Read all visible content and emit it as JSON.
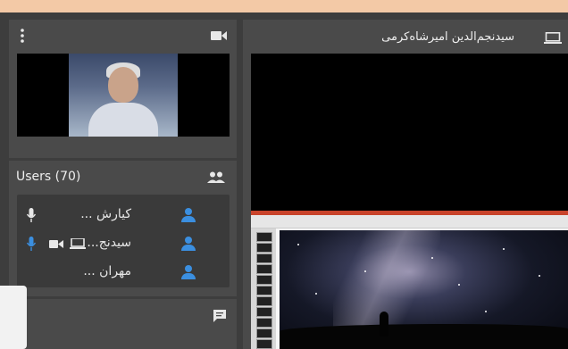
{
  "colors": {
    "top_strip": "#f3c9a6",
    "panel": "#4a4a4a",
    "accent_blue": "#3b8fe0"
  },
  "camera_panel": {
    "menu_icon": "kebab-menu-icon",
    "video_icon": "videocam-icon"
  },
  "users_panel": {
    "title": "Users (70)",
    "header_icon": "people-icon",
    "users": [
      {
        "name": "کیارش ...",
        "icons": [
          "microphone-icon"
        ],
        "mic_active": false
      },
      {
        "name": "سیدنج...",
        "icons": [
          "screen-share-icon",
          "videocam-icon",
          "microphone-icon"
        ],
        "mic_active": true
      },
      {
        "name": "مهران ...",
        "icons": [],
        "mic_active": false
      }
    ]
  },
  "chat_panel": {
    "icon": "chat-icon"
  },
  "share_panel": {
    "presenter_name": "سیدنجم‌الدین امیرشاه‌کرمی",
    "screen_icon": "laptop-icon"
  }
}
